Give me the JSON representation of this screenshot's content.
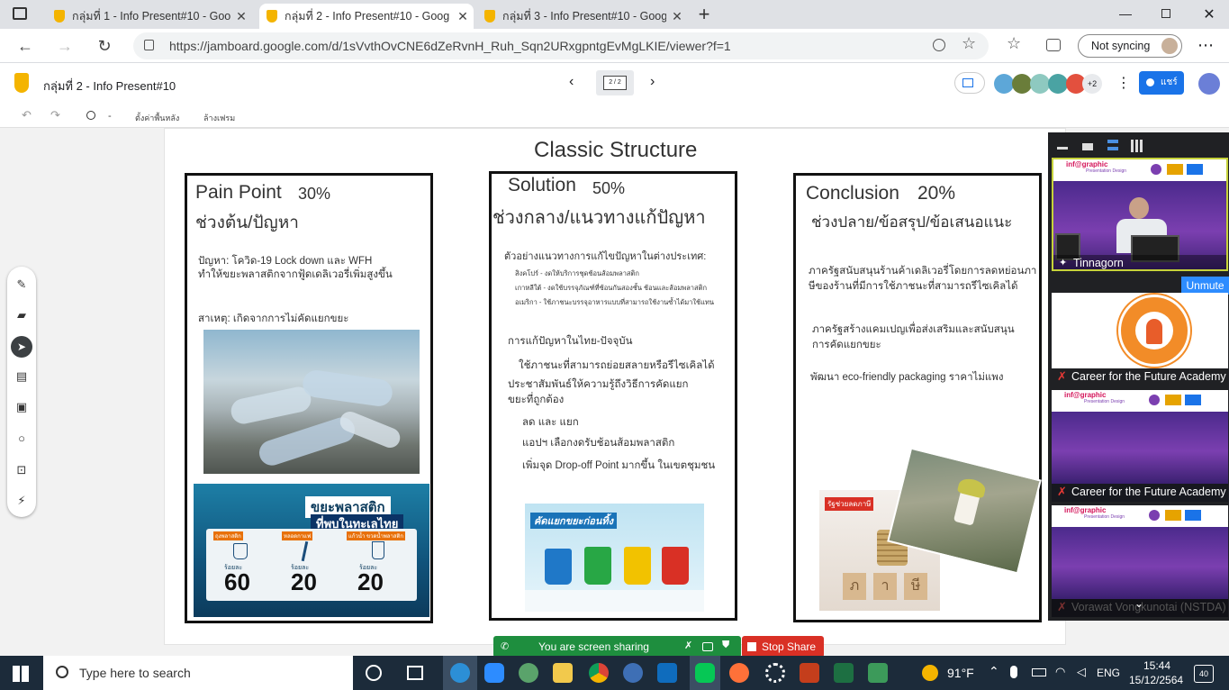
{
  "browser": {
    "tabs": [
      {
        "title": "กลุ่มที่ 1 - Info Present#10 - Goog",
        "active": false
      },
      {
        "title": "กลุ่มที่ 2 - Info Present#10 - Goog",
        "active": true
      },
      {
        "title": "กลุ่มที่ 3 - Info Present#10 - Goog",
        "active": false
      }
    ],
    "url": "https://jamboard.google.com/d/1sVvthOvCNE6dZeRvnH_Ruh_Sqn2URxgpntgEvMgLKIE/viewer?f=1",
    "sync_label": "Not syncing"
  },
  "jamboard": {
    "title": "กลุ่มที่ 2 - Info Present#10",
    "frame_counter": "2 / 2",
    "share_label": "แชร์",
    "extra_viewers": "+2",
    "toolbar": {
      "set_background": "ตั้งค่าพื้นหลัง",
      "clear_frame": "ล้างเฟรม",
      "zoom": "-"
    }
  },
  "slide": {
    "title": "Classic Structure",
    "pain": {
      "heading": "Pain Point",
      "percent": "30%",
      "subtitle": "ช่วงต้น/ปัญหา",
      "problem_line1": "ปัญหา: โควิด-19 Lock down และ WFH",
      "problem_line2": "ทำให้ขยะพลาสติกจากฟู้ดเดลิเวอรี่เพิ่มสูงขึ้น",
      "cause": "สาเหตุ: เกิดจากการไม่คัดแยกขยะ",
      "info_title1": "ขยะพลาสติก",
      "info_title2": "ที่พบในทะเลไทย",
      "info_labels": [
        "ถุงพลาสติก",
        "หลอดกาแฟ",
        "แก้วน้ำ ขวดน้ำพลาสติก"
      ],
      "info_values": [
        "60",
        "20",
        "20"
      ],
      "info_unit": "ร้อยละ"
    },
    "solution": {
      "heading": "Solution",
      "percent": "50%",
      "subtitle": "ช่วงกลาง/แนวทางแก้ปัญหา",
      "intl_title": "ตัวอย่างแนวทางการแก้ไขปัญหาในต่างประเทศ:",
      "intl_items": [
        "สิงคโปร์ - งดให้บริการชุดช้อนส้อมพลาสติก",
        "เกาหลีใต้ - งดใช้บรรจุภัณฑ์ที่ซ้อนกันสองชั้น ช้อนและส้อมพลาสติก",
        "อเมริกา - ใช้ภาชนะบรรจุอาหารแบบที่สามารถใช้งานซ้ำได้มาใช้แทน"
      ],
      "thai_title": "การแก้ปัญหาในไทย-ปัจจุบัน",
      "thai_items": [
        "ใช้ภาชนะที่สามารถย่อยสลายหรือรีไซเคิลได้",
        "ประชาสัมพันธ์ให้ความรู้ถึงวิธีการคัดแยก",
        "ขยะที่ถูกต้อง",
        "ลด และ แยก",
        "แอปฯ เลือกงดรับช้อนส้อมพลาสติก",
        "เพิ่มจุด Drop-off Point มากขึ้น ในเขตชุมชน"
      ],
      "bins_title": "คัดแยกขยะก่อนทิ้ง"
    },
    "conclusion": {
      "heading": "Conclusion",
      "percent": "20%",
      "subtitle": "ช่วงปลาย/ข้อสรุป/ข้อเสนอแนะ",
      "point1_line1": "ภาครัฐสนับสนุนร้านค้าเดลิเวอรี่โดยการลดหย่อนภา",
      "point1_line2": "ษีของร้านที่มีการใช้ภาชนะที่สามารถรีไซเคิลได้",
      "point2_line1": "ภาครัฐสร้างแคมเปญเพื่อส่งเสริมและสนับสนุน",
      "point2_line2": "การคัดแยกขยะ",
      "point3": "พัฒนา eco-friendly packaging ราคาไม่แพง",
      "tax_badge": "รัฐช่วยลดภาษี",
      "tax_blocks": [
        "ภ",
        "า",
        "ษี"
      ]
    }
  },
  "meet": {
    "participants": [
      {
        "name": "Tinnagorn",
        "muted": false
      },
      {
        "name": "Career for the Future Academy",
        "muted": true
      },
      {
        "name": "Career for the Future Academy",
        "muted": true
      },
      {
        "name": "Vorawat Vongkunotai (NSTDA)",
        "muted": true
      }
    ],
    "unmute_label": "Unmute",
    "slide_brand": "inf@graphic",
    "slide_sub": "Presentation Design"
  },
  "screen_share": {
    "status": "You are screen sharing",
    "stop_label": "Stop Share"
  },
  "taskbar": {
    "search_placeholder": "Type here to search",
    "weather": "91°F",
    "language": "ENG",
    "time": "15:44",
    "date": "15/12/2564",
    "notifications": "40"
  }
}
